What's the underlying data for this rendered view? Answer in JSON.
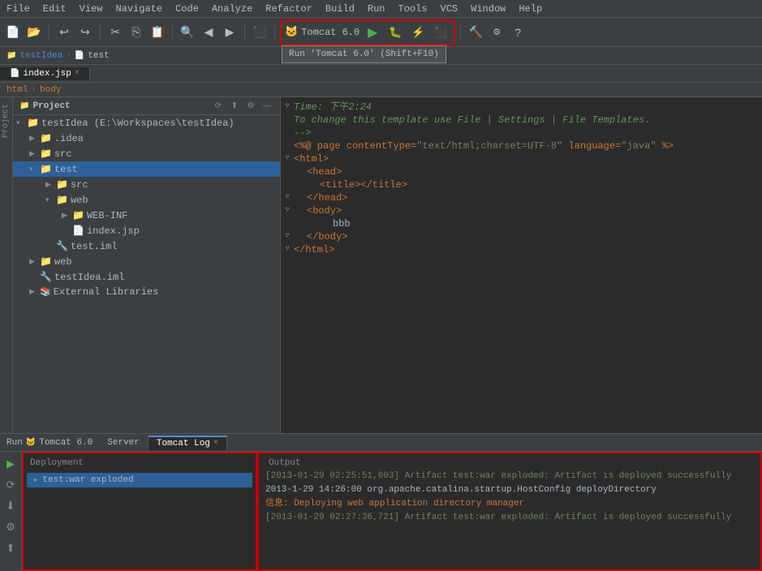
{
  "menubar": {
    "items": [
      "File",
      "Edit",
      "View",
      "Navigate",
      "Code",
      "Analyze",
      "Refactor",
      "Build",
      "Run",
      "Tools",
      "VCS",
      "Window",
      "Help"
    ]
  },
  "toolbar": {
    "run_config": "Tomcat 6.0",
    "tooltip": "Run 'Tomcat 6.0' (Shift+F10)"
  },
  "breadcrumb": {
    "project": "testIdea",
    "file": "test"
  },
  "sidebar": {
    "title": "Project",
    "root": "testIdea (E:\\Workspaces\\testIdea)",
    "items": [
      {
        "label": ".idea",
        "type": "folder",
        "indent": 1,
        "expanded": false
      },
      {
        "label": "src",
        "type": "folder",
        "indent": 1,
        "expanded": false
      },
      {
        "label": "test",
        "type": "folder",
        "indent": 1,
        "expanded": true
      },
      {
        "label": "src",
        "type": "folder",
        "indent": 2,
        "expanded": false
      },
      {
        "label": "web",
        "type": "folder",
        "indent": 2,
        "expanded": true
      },
      {
        "label": "WEB-INF",
        "type": "folder",
        "indent": 3,
        "expanded": false
      },
      {
        "label": "index.jsp",
        "type": "jsp",
        "indent": 3
      },
      {
        "label": "test.iml",
        "type": "iml",
        "indent": 2
      },
      {
        "label": "web",
        "type": "folder",
        "indent": 1,
        "expanded": false
      },
      {
        "label": "testIdea.iml",
        "type": "iml",
        "indent": 1
      },
      {
        "label": "External Libraries",
        "type": "library",
        "indent": 1,
        "expanded": false
      }
    ]
  },
  "editor": {
    "tab": "index.jsp",
    "lines": [
      {
        "num": "",
        "gutter": "▾",
        "content": "<span class='c-tag'>html</span> <span class='c-tag'>body</span>",
        "is_breadcrumb": true
      },
      {
        "num": "",
        "gutter": "",
        "content": ""
      },
      {
        "num": "",
        "gutter": "",
        "content": "<span class='c-comment'>  Time: 下午2:24</span>"
      },
      {
        "num": "",
        "gutter": "",
        "content": "<span class='c-comment'>  To change this template use File | Settings | File Templates.</span>"
      },
      {
        "num": "",
        "gutter": "",
        "content": "<span class='c-comment'>--&gt;</span>"
      },
      {
        "num": "",
        "gutter": "",
        "content": "<span class='c-directive'>&lt;%@ page contentType=</span><span class='c-string'>&quot;text/html;charset=UTF-8&quot;</span> <span class='c-attr'>language=</span><span class='c-string'>&quot;java&quot;</span><span class='c-directive'> %&gt;</span>"
      },
      {
        "num": "",
        "gutter": "▾",
        "content": "<span class='c-tag'>&lt;html&gt;</span>"
      },
      {
        "num": "",
        "gutter": "",
        "content": "  <span class='c-tag'>&lt;head&gt;</span>"
      },
      {
        "num": "",
        "gutter": "",
        "content": "    <span class='c-tag'>&lt;title&gt;</span><span class='c-tag'>&lt;/title&gt;</span>"
      },
      {
        "num": "",
        "gutter": "▿",
        "content": "  <span class='c-tag'>&lt;/head&gt;</span>"
      },
      {
        "num": "",
        "gutter": "▾",
        "content": "  <span class='c-tag'>&lt;body&gt;</span>"
      },
      {
        "num": "",
        "gutter": "",
        "content": "      bbb"
      },
      {
        "num": "",
        "gutter": "▿",
        "content": "  <span class='c-tag'>&lt;/body&gt;</span>"
      },
      {
        "num": "",
        "gutter": "▿",
        "content": "<span class='c-tag'>&lt;/html&gt;</span>"
      }
    ]
  },
  "bottom_panel": {
    "run_label": "Run",
    "tomcat_label": "Tomcat 6.0",
    "tabs": [
      {
        "label": "Server",
        "active": false
      },
      {
        "label": "Tomcat Log",
        "active": true
      }
    ],
    "deployment_header": "Deployment",
    "deployment_item": "test:war exploded",
    "output_label": "Output",
    "output_lines": [
      "[2013-01-29 02:25:51,603] Artifact test:war exploded: Artifact is deployed successfully",
      "2013-1-29 14:26:00 org.apache.catalina.startup.HostConfig deployDirectory",
      "信息: Deploying web application directory manager",
      "[2013-01-29 02:27:36,721] Artifact test:war exploded: Artifact is deployed successfully"
    ]
  }
}
